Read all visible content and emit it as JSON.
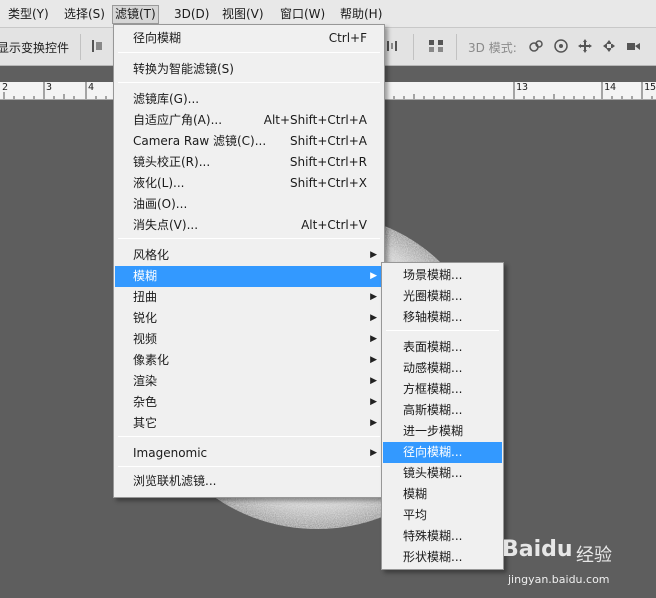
{
  "menubar": {
    "items": [
      {
        "label": "类型(Y)"
      },
      {
        "label": "选择(S)"
      },
      {
        "label": "滤镜(T)"
      },
      {
        "label": "3D(D)"
      },
      {
        "label": "视图(V)"
      },
      {
        "label": "窗口(W)"
      },
      {
        "label": "帮助(H)"
      }
    ],
    "active_index": 2
  },
  "options_bar": {
    "show_transform_label": "显示变换控件",
    "mode_3d_label": "3D 模式:"
  },
  "ruler": {
    "numbers": [
      "2",
      "3",
      "4",
      "13",
      "14",
      "15"
    ]
  },
  "filter_menu": {
    "last_filter": {
      "label": "径向模糊",
      "shortcut": "Ctrl+F"
    },
    "convert_smart": {
      "label": "转换为智能滤镜(S)"
    },
    "gallery": {
      "label": "滤镜库(G)..."
    },
    "adaptive_wide": {
      "label": "自适应广角(A)...",
      "shortcut": "Alt+Shift+Ctrl+A"
    },
    "camera_raw": {
      "label": "Camera Raw 滤镜(C)...",
      "shortcut": "Shift+Ctrl+A"
    },
    "lens_correction": {
      "label": "镜头校正(R)...",
      "shortcut": "Shift+Ctrl+R"
    },
    "liquify": {
      "label": "液化(L)...",
      "shortcut": "Shift+Ctrl+X"
    },
    "oil_paint": {
      "label": "油画(O)..."
    },
    "vanishing_point": {
      "label": "消失点(V)...",
      "shortcut": "Alt+Ctrl+V"
    },
    "stylize": {
      "label": "风格化"
    },
    "blur": {
      "label": "模糊"
    },
    "distort": {
      "label": "扭曲"
    },
    "sharpen": {
      "label": "锐化"
    },
    "video": {
      "label": "视频"
    },
    "pixelate": {
      "label": "像素化"
    },
    "render": {
      "label": "渲染"
    },
    "noise": {
      "label": "杂色"
    },
    "other": {
      "label": "其它"
    },
    "imagenomic": {
      "label": "Imagenomic"
    },
    "browse_online": {
      "label": "浏览联机滤镜..."
    }
  },
  "blur_submenu": {
    "field_blur": "场景模糊...",
    "iris_blur": "光圈模糊...",
    "tilt_shift": "移轴模糊...",
    "surface_blur": "表面模糊...",
    "motion_blur": "动感模糊...",
    "box_blur": "方框模糊...",
    "gaussian_blur": "高斯模糊...",
    "blur_more": "进一步模糊",
    "radial_blur": "径向模糊...",
    "lens_blur": "镜头模糊...",
    "blur": "模糊",
    "average": "平均",
    "smart_blur": "特殊模糊...",
    "shape_blur": "形状模糊..."
  },
  "highlight_color": "#3399ff",
  "watermark": {
    "logo": "Baidu",
    "experience": "经验",
    "url": "jingyan.baidu.com"
  }
}
